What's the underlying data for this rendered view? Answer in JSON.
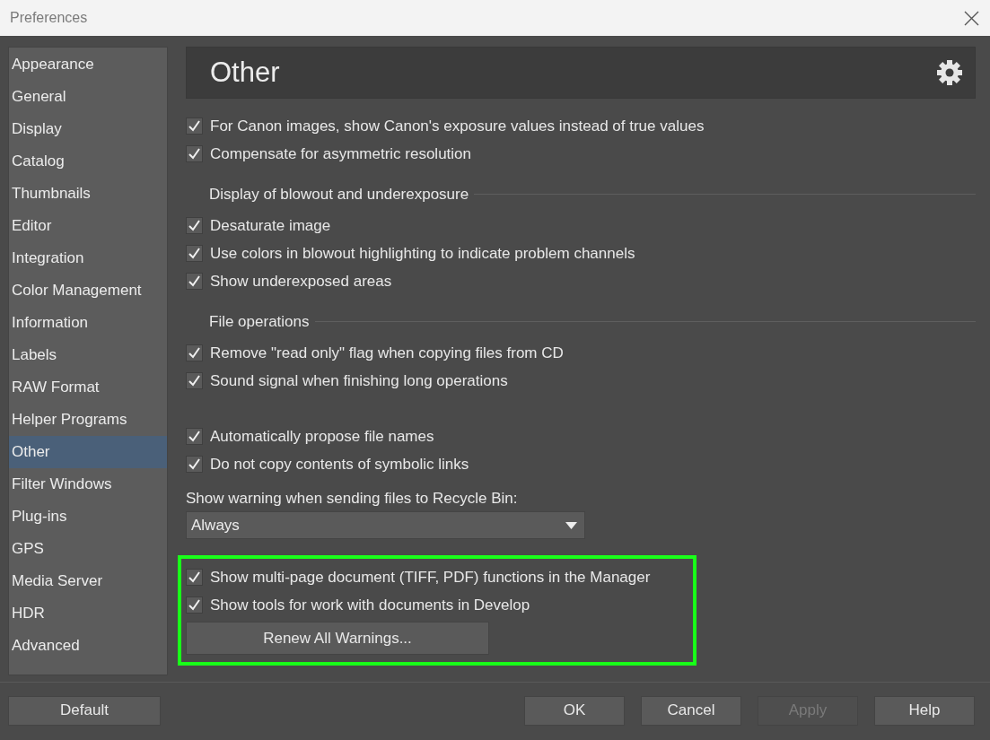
{
  "window": {
    "title": "Preferences"
  },
  "sidebar": {
    "items": [
      {
        "label": "Appearance",
        "selected": false
      },
      {
        "label": "General",
        "selected": false
      },
      {
        "label": "Display",
        "selected": false
      },
      {
        "label": "Catalog",
        "selected": false
      },
      {
        "label": "Thumbnails",
        "selected": false
      },
      {
        "label": "Editor",
        "selected": false
      },
      {
        "label": "Integration",
        "selected": false
      },
      {
        "label": "Color Management",
        "selected": false
      },
      {
        "label": "Information",
        "selected": false
      },
      {
        "label": "Labels",
        "selected": false
      },
      {
        "label": "RAW Format",
        "selected": false
      },
      {
        "label": "Helper Programs",
        "selected": false
      },
      {
        "label": "Other",
        "selected": true
      },
      {
        "label": "Filter Windows",
        "selected": false
      },
      {
        "label": "Plug-ins",
        "selected": false
      },
      {
        "label": "GPS",
        "selected": false
      },
      {
        "label": "Media Server",
        "selected": false
      },
      {
        "label": "HDR",
        "selected": false
      },
      {
        "label": "Advanced",
        "selected": false
      }
    ]
  },
  "header": {
    "title": "Other"
  },
  "groups": [
    {
      "kind": "plain",
      "items": [
        {
          "label": "For Canon images, show Canon's exposure values instead of true values",
          "checked": true
        },
        {
          "label": "Compensate for asymmetric resolution",
          "checked": true
        }
      ]
    },
    {
      "kind": "section",
      "title": "Display of blowout and underexposure",
      "items": [
        {
          "label": "Desaturate image",
          "checked": true
        },
        {
          "label": "Use colors in blowout highlighting to indicate problem channels",
          "checked": true
        },
        {
          "label": "Show underexposed areas",
          "checked": true
        }
      ]
    },
    {
      "kind": "section",
      "title": "File operations",
      "items": [
        {
          "label": "Remove \"read only\" flag when copying files from CD",
          "checked": true
        },
        {
          "label": "Sound signal when finishing long operations",
          "checked": true
        }
      ]
    },
    {
      "kind": "plain",
      "items": [
        {
          "label": "Automatically propose file names",
          "checked": true
        },
        {
          "label": "Do not copy contents of symbolic links",
          "checked": true
        }
      ]
    }
  ],
  "recycle_warning": {
    "label": "Show warning when sending files to Recycle Bin:",
    "value": "Always"
  },
  "highlighted": {
    "items": [
      {
        "label": "Show multi-page document (TIFF, PDF) functions in the Manager",
        "checked": true
      },
      {
        "label": "Show tools for work with documents in Develop",
        "checked": true
      }
    ],
    "button": "Renew All Warnings..."
  },
  "footer": {
    "default_button": "Default",
    "buttons": [
      {
        "label": "OK",
        "disabled": false
      },
      {
        "label": "Cancel",
        "disabled": false
      },
      {
        "label": "Apply",
        "disabled": true
      },
      {
        "label": "Help",
        "disabled": false
      }
    ]
  }
}
